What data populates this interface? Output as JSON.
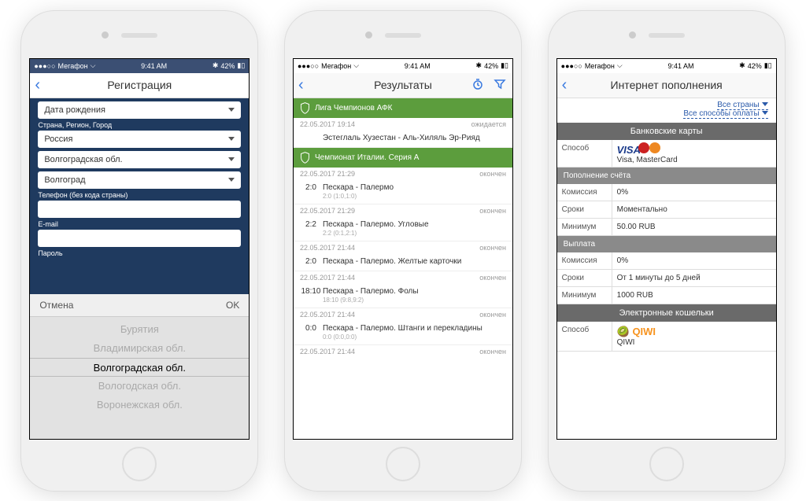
{
  "status": {
    "carrier": "Мегафон",
    "time": "9:41 AM",
    "battery": "42%"
  },
  "phone1": {
    "title": "Регистрация",
    "picker_cancel": "Отмена",
    "picker_ok": "OK",
    "fields": {
      "dob_label": "Дата рождения",
      "location_label": "Страна, Регион, Город",
      "country": "Россия",
      "region": "Волгоградская обл.",
      "city": "Волгоград",
      "phone_label": "Телефон (без кода страны)",
      "email_label": "E-mail",
      "password_label": "Пароль"
    },
    "picker_items": [
      "Бурятия",
      "Владимирская обл.",
      "Волгоградская обл.",
      "Вологодская обл.",
      "Воронежская обл."
    ]
  },
  "phone2": {
    "title": "Результаты",
    "status_pending": "ожидается",
    "status_done": "окончен",
    "league1": "Лига Чемпионов АФК",
    "league2": "Чемпионат Италии. Серия А",
    "match0": {
      "time": "22.05.2017 19:14",
      "teams": "Эстеглаль Хузестан - Аль-Хиляль Эр-Рияд"
    },
    "match1": {
      "time": "22.05.2017 21:29",
      "score": "2:0",
      "teams": "Пескара - Палермо",
      "sub": "2:0 (1:0,1:0)"
    },
    "match2": {
      "time": "22.05.2017 21:29",
      "score": "2:2",
      "teams": "Пескара - Палермо. Угловые",
      "sub": "2:2 (0:1,2:1)"
    },
    "match3": {
      "time": "22.05.2017 21:44",
      "score": "2:0",
      "teams": "Пескара - Палермо. Желтые карточки"
    },
    "match4": {
      "time": "22.05.2017 21:44",
      "score": "18:10",
      "teams": "Пескара - Палермо. Фолы",
      "sub": "18:10 (9:8,9:2)"
    },
    "match5": {
      "time": "22.05.2017 21:44",
      "score": "0:0",
      "teams": "Пескара - Палермо. Штанги и перекладины",
      "sub": "0:0 (0:0,0:0)"
    },
    "match6": {
      "time": "22.05.2017 21:44"
    }
  },
  "phone3": {
    "title": "Интернет пополнения",
    "filter_country": "Все страны",
    "filter_method": "Все способы оплаты",
    "sec_cards": "Банковские карты",
    "sec_refill": "Пополнение счёта",
    "sec_payout": "Выплата",
    "sec_wallets": "Электронные кошельки",
    "lbl_method": "Способ",
    "lbl_fee": "Комиссия",
    "lbl_time": "Сроки",
    "lbl_min": "Минимум",
    "card_name": "Visa, MasterCard",
    "fee_val": "0%",
    "time_instant": "Моментально",
    "min_refill": "50.00 RUB",
    "payout_time": "От 1 минуты до 5 дней",
    "payout_min": "1000 RUB",
    "qiwi": "QIWI"
  }
}
